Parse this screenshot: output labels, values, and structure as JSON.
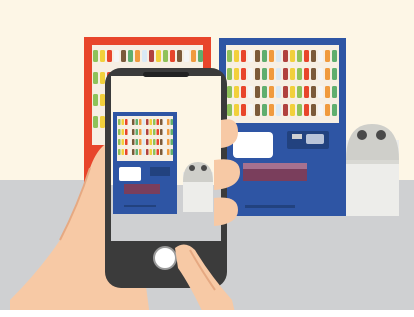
{
  "scene": {
    "subject": "hand-holding-smartphone-photographing-vending-machines",
    "palette": {
      "wall": "#fdf6e6",
      "floor": "#cfd0d2",
      "red_machine": "#e8452b",
      "blue_machine": "#2e55a4",
      "blue_machine_dark": "#22427f",
      "trash_bin": "#ededea",
      "trash_bin_lid": "#cfcfca",
      "phone_body": "#3b3b3b",
      "skin": "#f7c9a5",
      "skin_shadow": "#e6a982",
      "sleeve": "#f4e7d5"
    }
  },
  "phone": {
    "camera_button_icon": "circle-shutter-icon"
  }
}
